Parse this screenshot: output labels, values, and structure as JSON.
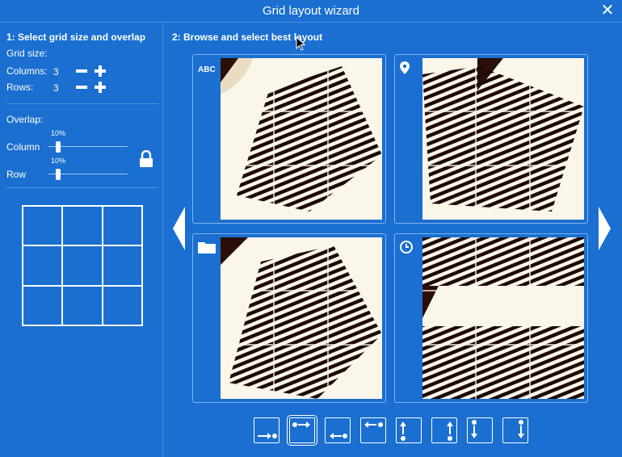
{
  "window": {
    "title": "Grid layout wizard",
    "close_icon": "close-icon"
  },
  "left": {
    "section_title": "1: Select grid size and overlap",
    "grid_size_label": "Grid size:",
    "columns_label": "Columns:",
    "columns_value": "3",
    "rows_label": "Rows:",
    "rows_value": "3",
    "overlap_label": "Overlap:",
    "column_label": "Column",
    "column_overlap": "10%",
    "column_overlap_fraction": 0.1,
    "row_label": "Row",
    "row_overlap": "10%",
    "row_overlap_fraction": 0.1,
    "preview_grid": {
      "columns": 3,
      "rows": 3
    }
  },
  "right": {
    "section_title": "2: Browse and select best layout",
    "cards": [
      {
        "icon": "abc-icon",
        "icon_text": "ABC"
      },
      {
        "icon": "location-pin-icon"
      },
      {
        "icon": "folder-icon"
      },
      {
        "icon": "clock-icon"
      }
    ],
    "toolbar": [
      {
        "icon": "fill-order-right-bottom-icon",
        "selected": false
      },
      {
        "icon": "fill-order-right-top-icon",
        "selected": true
      },
      {
        "icon": "fill-order-left-bottom-icon",
        "selected": false
      },
      {
        "icon": "fill-order-left-top-icon",
        "selected": false
      },
      {
        "icon": "fill-order-up-left-icon",
        "selected": false
      },
      {
        "icon": "fill-order-up-right-icon",
        "selected": false
      },
      {
        "icon": "fill-order-down-left-icon",
        "selected": false
      },
      {
        "icon": "fill-order-down-right-icon",
        "selected": false
      }
    ]
  },
  "colors": {
    "background": "#1a6fd0",
    "foreground": "#ffffff",
    "stripes": "#1e0b08",
    "photo": "#fbf6ea"
  }
}
